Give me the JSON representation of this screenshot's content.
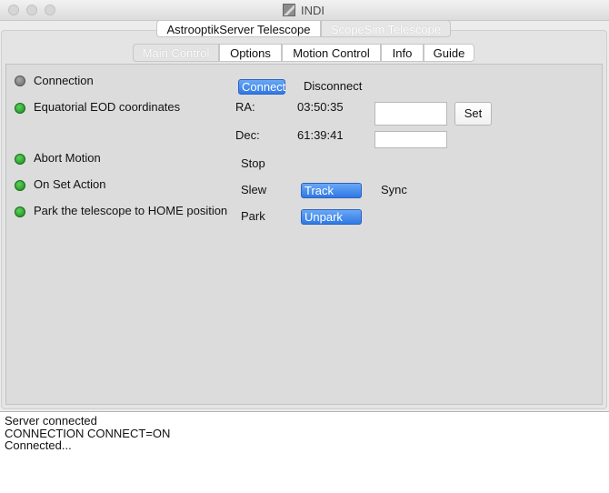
{
  "window": {
    "title": "INDI"
  },
  "device_tabs": [
    {
      "label": "AstrooptikServer Telescope",
      "active": true
    },
    {
      "label": "ScopeSim Telescope",
      "active": false
    }
  ],
  "group_tabs": [
    {
      "label": "Main Control",
      "active": true
    },
    {
      "label": "Options",
      "active": false
    },
    {
      "label": "Motion Control",
      "active": false
    },
    {
      "label": "Info",
      "active": false
    },
    {
      "label": "Guide",
      "active": false
    }
  ],
  "properties": {
    "connection": {
      "label": "Connection",
      "state": "idle",
      "connect": "Connect",
      "disconnect": "Disconnect"
    },
    "eod": {
      "label": "Equatorial EOD coordinates",
      "state": "ok",
      "ra_label": "RA:",
      "ra_value": "03:50:35",
      "ra_input": "",
      "dec_label": "Dec:",
      "dec_value": "61:39:41",
      "dec_input": "",
      "set": "Set"
    },
    "abort": {
      "label": "Abort Motion",
      "state": "ok",
      "stop": "Stop"
    },
    "on_set": {
      "label": "On Set Action",
      "state": "ok",
      "slew": "Slew",
      "track": "Track",
      "sync": "Sync"
    },
    "park": {
      "label": "Park the telescope to HOME position",
      "state": "ok",
      "park": "Park",
      "unpark": "Unpark"
    }
  },
  "log": {
    "lines": [
      "Server connected",
      "CONNECTION CONNECT=ON",
      "Connected..."
    ]
  },
  "colors": {
    "led_ok": "#1f9a1f",
    "led_idle": "#808080",
    "button_active": "#2f78e6"
  }
}
